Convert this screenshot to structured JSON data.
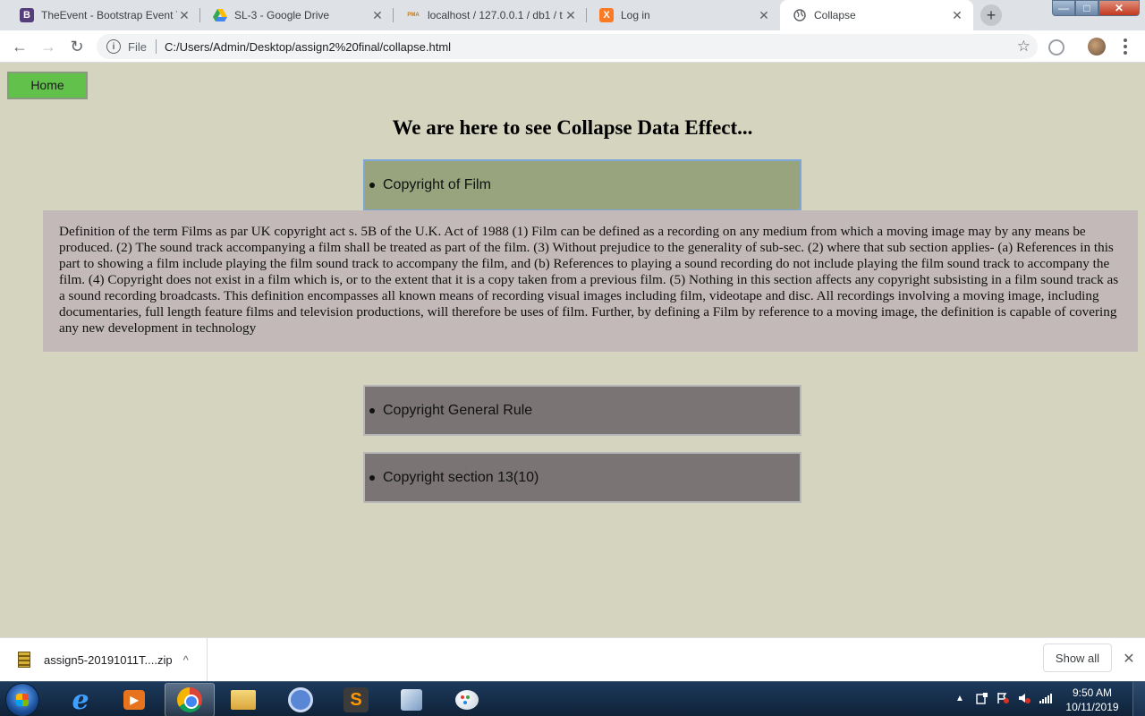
{
  "browser": {
    "tabs": [
      {
        "title": "TheEvent - Bootstrap Event T",
        "icon": "bootstrap-icon",
        "favicon_text": "B",
        "favicon_color": "#563d7c",
        "close": "✕"
      },
      {
        "title": "SL-3 - Google Drive",
        "icon": "google-drive-icon",
        "close": "✕"
      },
      {
        "title": "localhost / 127.0.0.1 / db1 / t",
        "icon": "phpmyadmin-icon",
        "favicon_text": "PMA",
        "close": "✕"
      },
      {
        "title": "Log in",
        "icon": "xampp-icon",
        "favicon_text": "X",
        "favicon_color": "#fb7a24",
        "close": "✕"
      },
      {
        "title": "Collapse",
        "icon": "globe-icon",
        "close": "✕",
        "active": true
      }
    ],
    "new_tab_label": "+",
    "nav": {
      "back": "←",
      "forward": "→",
      "reload": "↻"
    },
    "address": {
      "info_symbol": "i",
      "scheme": "File",
      "url": "C:/Users/Admin/Desktop/assign2%20final/collapse.html"
    },
    "bookmark_star": "☆",
    "menu": "⋮",
    "window_controls": {
      "minimize": "—",
      "maximize": "□",
      "close": "✕"
    }
  },
  "page": {
    "home_button": "Home",
    "title": "We are here to see Collapse Data Effect...",
    "accordion": [
      {
        "label": "Copyright of Film",
        "open": true,
        "content": "Definition of the term Films as par UK copyright act s. 5B of the U.K. Act of 1988 (1) Film can be defined as a recording on any medium from which a moving image may by any means be produced. (2) The sound track accompanying a film shall be treated as part of the film. (3) Without prejudice to the generality of sub-sec. (2) where that sub section applies- (a) References in this part to showing a film include playing the film sound track to accompany the film, and (b) References to playing a sound recording do not include playing the film sound track to accompany the film. (4) Copyright does not exist in a film which is, or to the extent that it is a copy taken from a previous film. (5) Nothing in this section affects any copyright subsisting in a film sound track as a sound recording broadcasts. This definition encompasses all known means of recording visual images including film, videotape and disc. All recordings involving a moving image, including documentaries, full length feature films and television productions, will therefore be uses of film. Further, by defining a Film by reference to a moving image, the definition is capable of covering any new development in technology"
      },
      {
        "label": "Copyright General Rule",
        "open": false
      },
      {
        "label": "Copyright section 13(10)",
        "open": false
      }
    ],
    "colors": {
      "background": "#d4d4bf",
      "home_button": "#62c14a",
      "open_header": "#97a47e",
      "closed_header": "#7a7474",
      "panel": "#c3b9b9"
    }
  },
  "downloads": {
    "file_name": "assign5-20191011T....zip",
    "chevron": "^",
    "show_all": "Show all",
    "close": "✕"
  },
  "taskbar": {
    "apps": [
      {
        "name": "internet-explorer-icon",
        "glyph": "e"
      },
      {
        "name": "media-player-icon",
        "glyph": "▶"
      },
      {
        "name": "chrome-icon",
        "active": true
      },
      {
        "name": "file-explorer-icon"
      },
      {
        "name": "chrome-alt-icon"
      },
      {
        "name": "sublime-text-icon",
        "glyph": "S"
      },
      {
        "name": "virtualbox-icon"
      },
      {
        "name": "paint-icon"
      }
    ],
    "tray_arrow": "▲",
    "clock": {
      "time": "9:50 AM",
      "date": "10/11/2019"
    }
  }
}
